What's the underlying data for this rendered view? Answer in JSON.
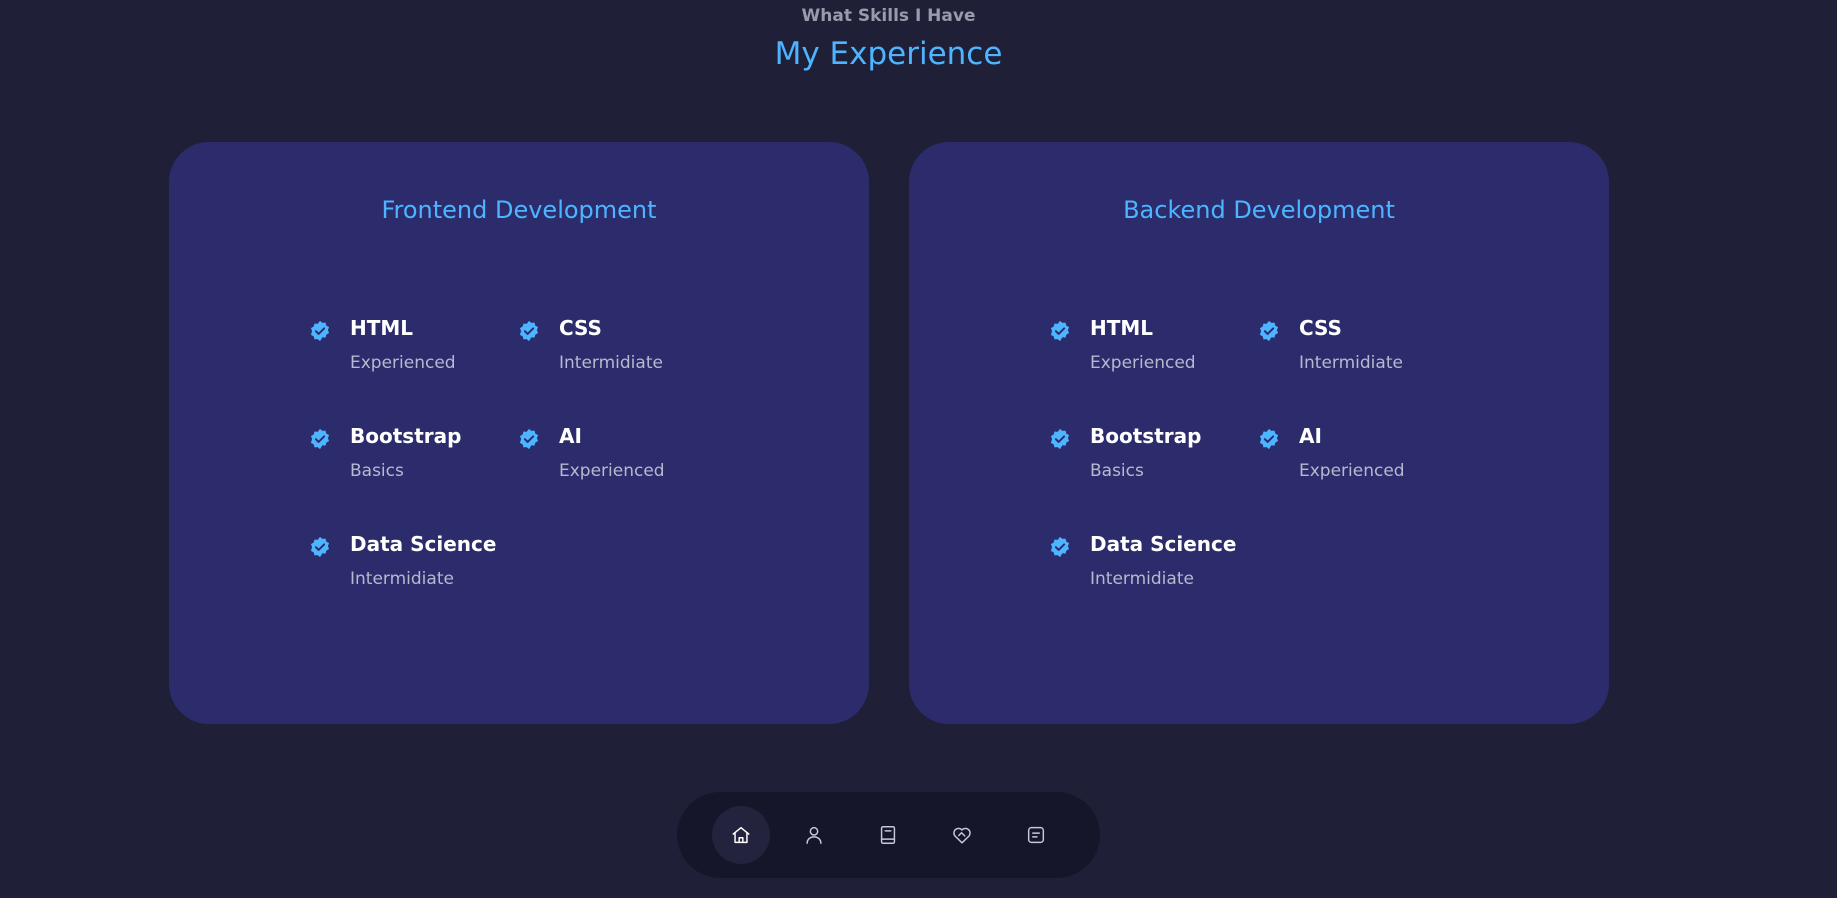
{
  "header": {
    "subtitle": "What Skills I Have",
    "title": "My Experience"
  },
  "colors": {
    "background": "#1f1f38",
    "card": "#2c2c6c",
    "accent": "#4db5ff",
    "nav_bg": "#16162a"
  },
  "frontend": {
    "title": "Frontend Development",
    "skills": [
      {
        "name": "HTML",
        "level": "Experienced"
      },
      {
        "name": "CSS",
        "level": "Intermidiate"
      },
      {
        "name": "Bootstrap",
        "level": "Basics"
      },
      {
        "name": "AI",
        "level": "Experienced"
      },
      {
        "name": "Data Science",
        "level": "Intermidiate"
      }
    ]
  },
  "backend": {
    "title": "Backend Development",
    "skills": [
      {
        "name": "HTML",
        "level": "Experienced"
      },
      {
        "name": "CSS",
        "level": "Intermidiate"
      },
      {
        "name": "Bootstrap",
        "level": "Basics"
      },
      {
        "name": "AI",
        "level": "Experienced"
      },
      {
        "name": "Data Science",
        "level": "Intermidiate"
      }
    ]
  },
  "nav": {
    "items": [
      {
        "icon": "home-icon",
        "active": true
      },
      {
        "icon": "user-icon",
        "active": false
      },
      {
        "icon": "book-icon",
        "active": false
      },
      {
        "icon": "services-icon",
        "active": false
      },
      {
        "icon": "message-icon",
        "active": false
      }
    ]
  }
}
